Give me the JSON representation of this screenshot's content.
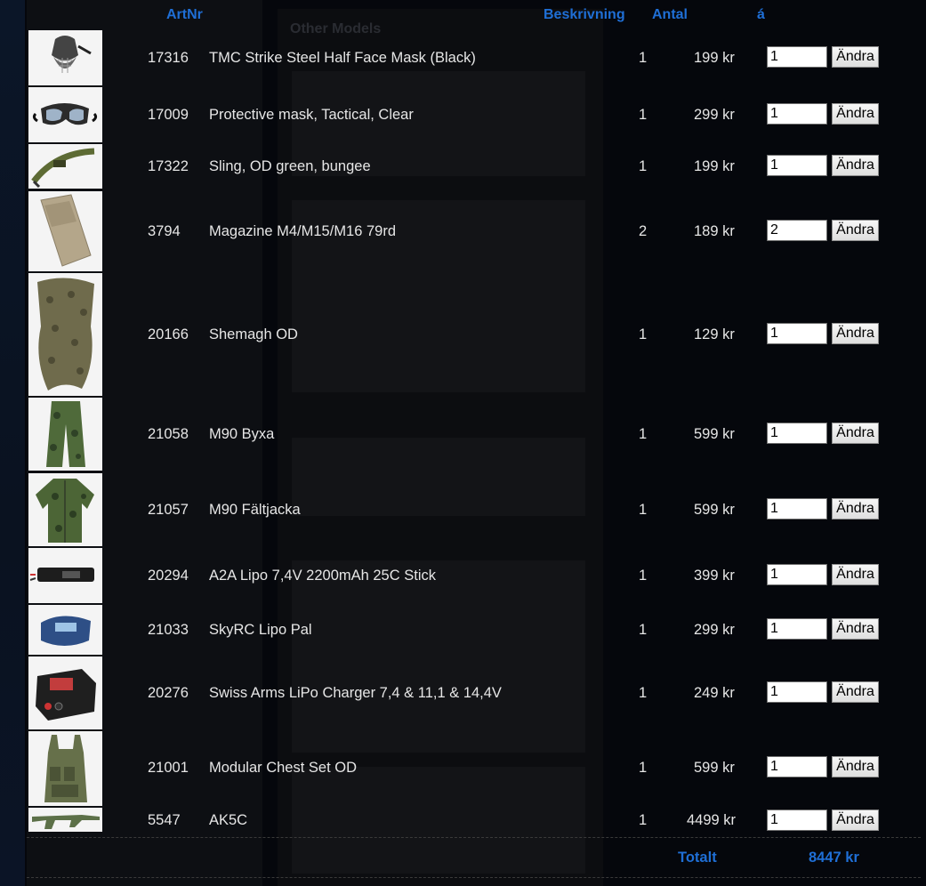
{
  "header": {
    "artnr": "ArtNr",
    "beskrivning": "Beskrivning",
    "antal": "Antal",
    "a": "á"
  },
  "background": {
    "heading": "Other Models"
  },
  "button_label": "Ändra",
  "items": [
    {
      "artnr": "17316",
      "desc": "TMC Strike Steel Half Face Mask (Black)",
      "qty": "1",
      "price": "199 kr",
      "input": "1"
    },
    {
      "artnr": "17009",
      "desc": "Protective mask, Tactical, Clear",
      "qty": "1",
      "price": "299 kr",
      "input": "1"
    },
    {
      "artnr": "17322",
      "desc": "Sling, OD green, bungee",
      "qty": "1",
      "price": "199 kr",
      "input": "1"
    },
    {
      "artnr": "3794",
      "desc": "Magazine M4/M15/M16 79rd",
      "qty": "2",
      "price": "189 kr",
      "input": "2"
    },
    {
      "artnr": "20166",
      "desc": "Shemagh OD",
      "qty": "1",
      "price": "129 kr",
      "input": "1"
    },
    {
      "artnr": "21058",
      "desc": "M90 Byxa",
      "qty": "1",
      "price": "599 kr",
      "input": "1"
    },
    {
      "artnr": "21057",
      "desc": "M90 Fältjacka",
      "qty": "1",
      "price": "599 kr",
      "input": "1"
    },
    {
      "artnr": "20294",
      "desc": "A2A Lipo 7,4V 2200mAh 25C Stick",
      "qty": "1",
      "price": "399 kr",
      "input": "1"
    },
    {
      "artnr": "21033",
      "desc": "SkyRC Lipo Pal",
      "qty": "1",
      "price": "299 kr",
      "input": "1"
    },
    {
      "artnr": "20276",
      "desc": "Swiss Arms LiPo Charger 7,4 & 11,1 & 14,4V",
      "qty": "1",
      "price": "249 kr",
      "input": "1"
    },
    {
      "artnr": "21001",
      "desc": "Modular Chest Set OD",
      "qty": "1",
      "price": "599 kr",
      "input": "1"
    },
    {
      "artnr": "5547",
      "desc": "AK5C",
      "qty": "1",
      "price": "4499 kr",
      "input": "1"
    }
  ],
  "totals": {
    "label": "Totalt",
    "value": "8447 kr"
  },
  "colors": {
    "accent": "#1f6fd6",
    "background": "#05070c"
  }
}
